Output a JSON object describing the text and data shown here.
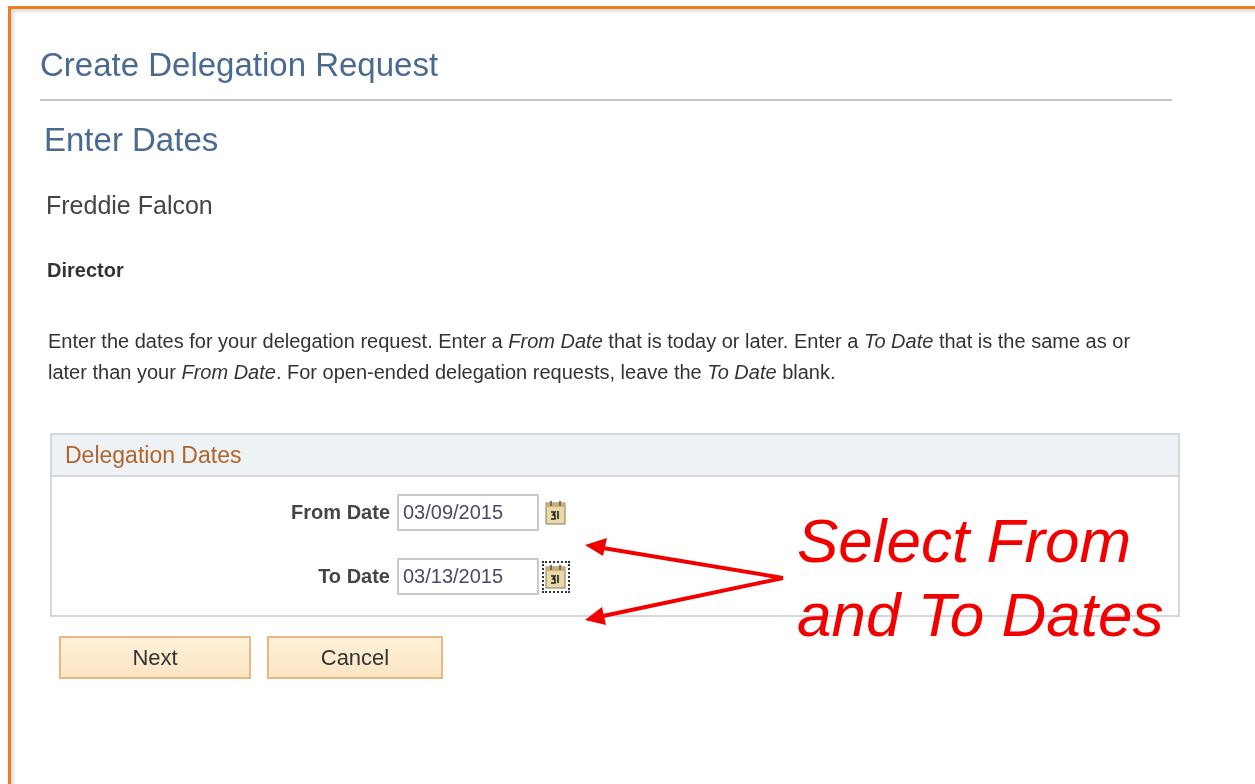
{
  "page": {
    "title": "Create Delegation Request",
    "subtitle": "Enter Dates",
    "person": "Freddie Falcon",
    "role": "Director",
    "instructions": "Enter the dates for your delegation request. Enter a *From Date* that is today or later. Enter a *To Date* that is the same as or later than your *From Date*. For open-ended delegation requests, leave the *To Date* blank."
  },
  "group": {
    "title": "Delegation Dates",
    "fields": [
      {
        "label": "From Date",
        "value": "03/09/2015",
        "focused": false
      },
      {
        "label": "To Date",
        "value": "03/13/2015",
        "focused": true
      }
    ]
  },
  "buttons": [
    {
      "label": "Next"
    },
    {
      "label": "Cancel"
    }
  ],
  "annotation": {
    "lines": [
      "Select From",
      "and To Dates"
    ]
  }
}
